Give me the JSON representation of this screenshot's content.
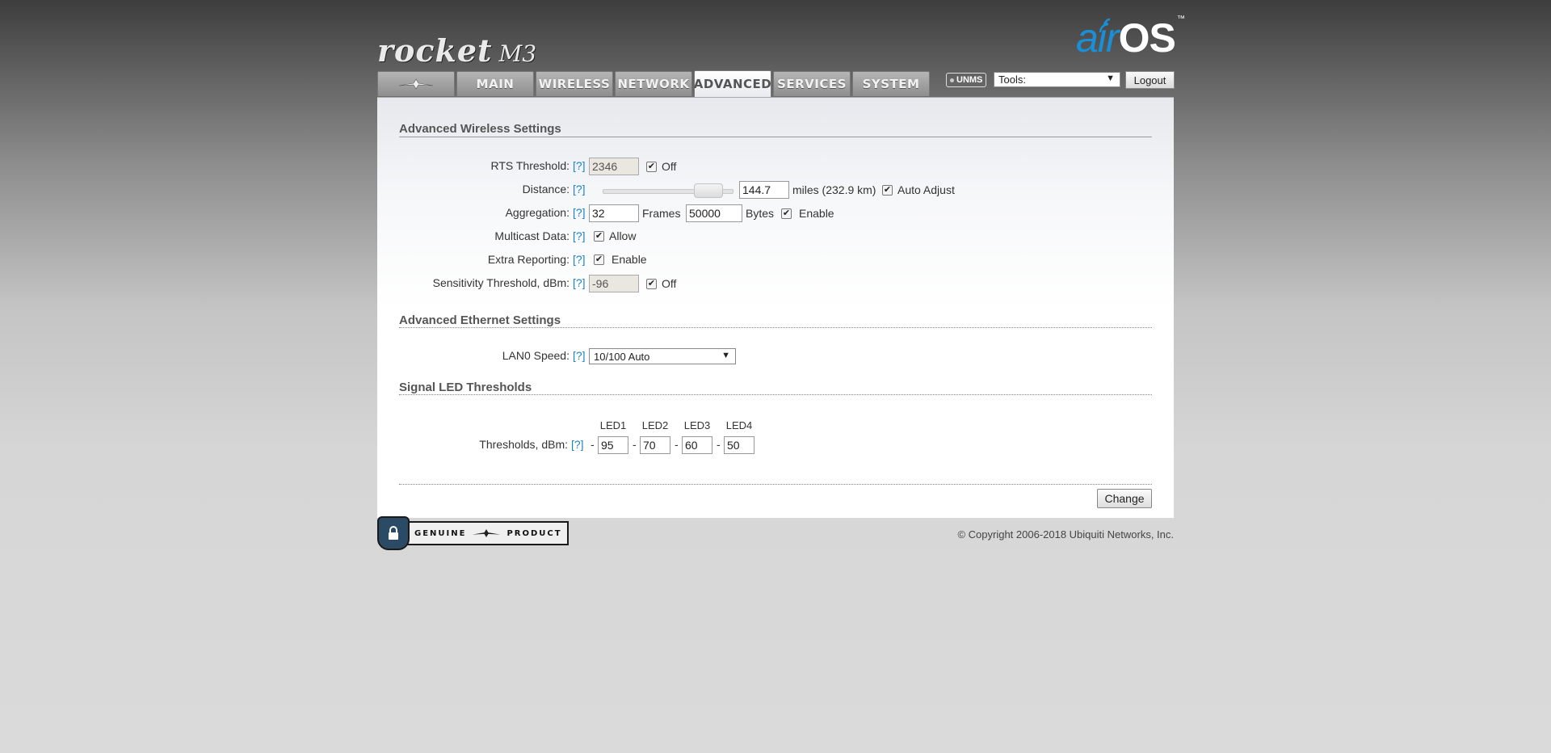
{
  "header": {
    "product_name": "rocket",
    "product_model": "M3",
    "brand_air": "air",
    "brand_os": "OS",
    "brand_tm": "™"
  },
  "tabs": [
    {
      "label": "",
      "icon": "ubiquiti-logo-icon"
    },
    {
      "label": "MAIN"
    },
    {
      "label": "WIRELESS"
    },
    {
      "label": "NETWORK"
    },
    {
      "label": "ADVANCED",
      "active": true
    },
    {
      "label": "SERVICES"
    },
    {
      "label": "SYSTEM"
    }
  ],
  "toolbar": {
    "unms_label": "UNMS",
    "tools_label": "Tools:",
    "logout_label": "Logout"
  },
  "wireless": {
    "title": "Advanced Wireless Settings",
    "help": "[?]",
    "rts_label": "RTS Threshold:",
    "rts_value": "2346",
    "rts_off_label": "Off",
    "distance_label": "Distance:",
    "distance_value": "144.7",
    "distance_units": "miles (232.9 km)",
    "distance_slider_fraction": 0.88,
    "auto_adjust_label": "Auto Adjust",
    "aggregation_label": "Aggregation:",
    "aggregation_frames": "32",
    "frames_label": "Frames",
    "aggregation_bytes": "50000",
    "bytes_label": "Bytes",
    "aggregation_enable_label": "Enable",
    "multicast_label": "Multicast Data:",
    "multicast_allow_label": "Allow",
    "extra_reporting_label": "Extra Reporting:",
    "extra_reporting_enable_label": "Enable",
    "sensitivity_label": "Sensitivity Threshold, dBm:",
    "sensitivity_value": "-96",
    "sensitivity_off_label": "Off"
  },
  "ethernet": {
    "title": "Advanced Ethernet Settings",
    "lan0_label": "LAN0 Speed:",
    "lan0_value": "10/100 Auto"
  },
  "led": {
    "title": "Signal LED Thresholds",
    "headers": [
      "LED1",
      "LED2",
      "LED3",
      "LED4"
    ],
    "thresholds_label": "Thresholds, dBm:",
    "dash": "-",
    "values": [
      "95",
      "70",
      "60",
      "50"
    ]
  },
  "actions": {
    "change_label": "Change"
  },
  "footer": {
    "genuine_left": "GENUINE",
    "genuine_right": "PRODUCT",
    "copyright": "© Copyright 2006-2018 Ubiquiti Networks, Inc."
  }
}
